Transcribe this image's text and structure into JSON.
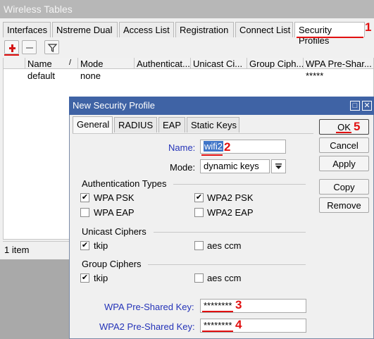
{
  "outer_window": {
    "title": "Wireless Tables",
    "tabs": [
      "Interfaces",
      "Nstreme Dual",
      "Access List",
      "Registration",
      "Connect List",
      "Security Profiles"
    ],
    "active_tab": "Security Profiles",
    "columns": [
      "Name",
      "Mode",
      "Authenticat...",
      "Unicast Ci...",
      "Group Ciph...",
      "WPA Pre-Shar..."
    ],
    "rows": [
      {
        "name": "default",
        "mode": "none",
        "wpa_key": "*****"
      }
    ],
    "sort_indicator": "/",
    "status": "1 item"
  },
  "dialog": {
    "title": "New Security Profile",
    "tabs": [
      "General",
      "RADIUS",
      "EAP",
      "Static Keys"
    ],
    "active_tab": "General",
    "name_label": "Name:",
    "name_value": "wifi2",
    "mode_label": "Mode:",
    "mode_value": "dynamic keys",
    "auth_group_label": "Authentication Types",
    "auth_types": [
      {
        "label": "WPA PSK",
        "checked": true
      },
      {
        "label": "WPA2 PSK",
        "checked": true
      },
      {
        "label": "WPA EAP",
        "checked": false
      },
      {
        "label": "WPA2 EAP",
        "checked": false
      }
    ],
    "unicast_group_label": "Unicast Ciphers",
    "unicast_ciphers": [
      {
        "label": "tkip",
        "checked": true
      },
      {
        "label": "aes ccm",
        "checked": false
      }
    ],
    "group_group_label": "Group Ciphers",
    "group_ciphers": [
      {
        "label": "tkip",
        "checked": true
      },
      {
        "label": "aes ccm",
        "checked": false
      }
    ],
    "wpa_key_label": "WPA Pre-Shared Key:",
    "wpa_key_value": "********",
    "wpa2_key_label": "WPA2 Pre-Shared Key:",
    "wpa2_key_value": "********",
    "buttons": {
      "ok": "OK",
      "cancel": "Cancel",
      "apply": "Apply",
      "copy": "Copy",
      "remove": "Remove"
    },
    "window_buttons": {
      "restore": "□",
      "close": "✕"
    }
  },
  "annotations": {
    "one": "1",
    "two": "2",
    "three": "3",
    "four": "4",
    "five": "5"
  },
  "icons": [
    "add-icon",
    "remove-icon",
    "filter-icon",
    "sort-icon",
    "dropdown-arrow-icon",
    "checkmark-icon"
  ],
  "colors": {
    "annotation": "#e11010",
    "dialog_title": "#3f63a5",
    "label_blue": "#2433b8"
  }
}
